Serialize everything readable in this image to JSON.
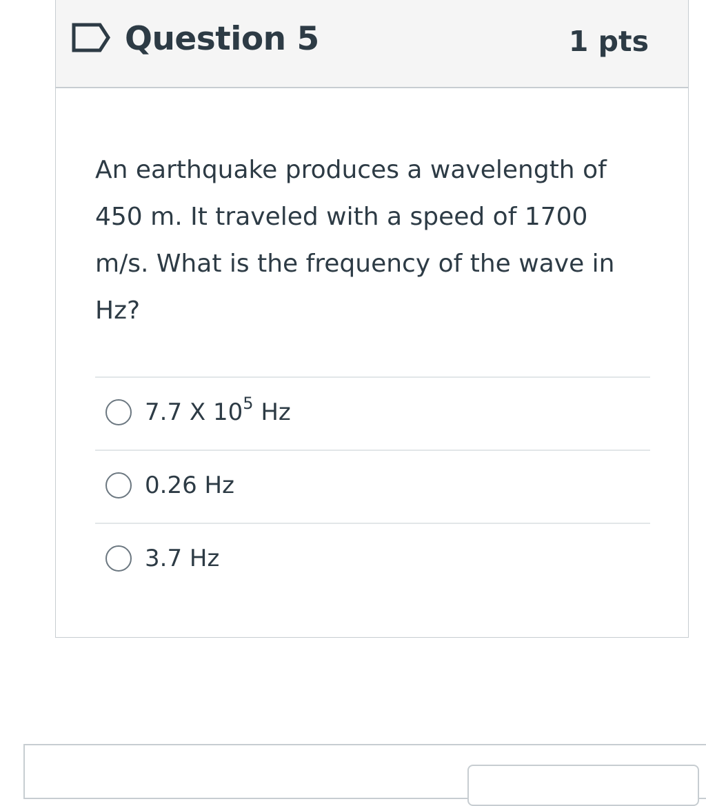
{
  "question": {
    "title": "Question 5",
    "points": "1 pts",
    "text": "An earthquake produces a wavelength of 450 m. It traveled with a speed of 1700 m/s. What is the frequency of the wave in Hz?",
    "flag_icon": "flag-outline-icon",
    "answers": [
      {
        "label_base": "7.7 X 10",
        "label_exponent": "5",
        "label_unit": " Hz",
        "selected": false
      },
      {
        "label": "0.26 Hz",
        "selected": false
      },
      {
        "label": "3.7 Hz",
        "selected": false
      }
    ]
  },
  "colors": {
    "header_bg": "#f5f5f5",
    "border": "#c7cdd1",
    "text": "#2d3b45",
    "radio_border": "#6b7780"
  }
}
